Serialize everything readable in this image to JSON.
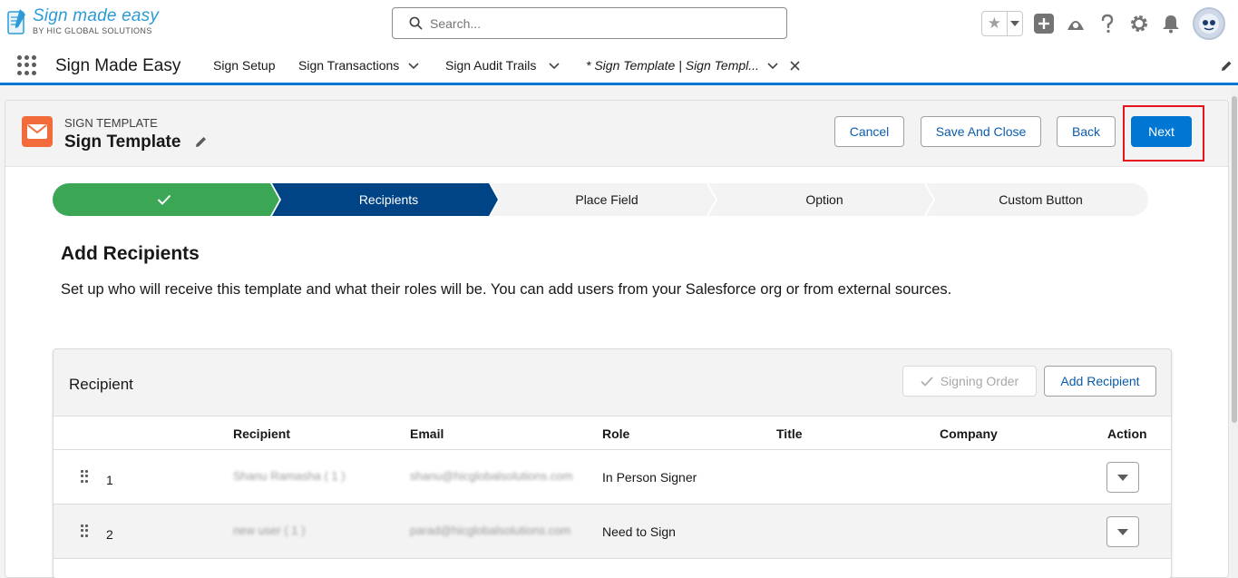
{
  "brand": {
    "title": "Sign made easy",
    "subtitle": "BY HIC GLOBAL SOLUTIONS"
  },
  "search": {
    "placeholder": "Search..."
  },
  "app_nav": {
    "app_name": "Sign Made Easy",
    "items": [
      {
        "label": "Sign Setup",
        "has_menu": false
      },
      {
        "label": "Sign Transactions",
        "has_menu": true
      },
      {
        "label": "Sign Audit Trails",
        "has_menu": true
      },
      {
        "label": "* Sign Template | Sign Templ...",
        "has_menu": true,
        "active": true,
        "closable": true
      }
    ]
  },
  "record": {
    "type_label": "SIGN TEMPLATE",
    "title": "Sign Template",
    "icon": "email-icon",
    "buttons": {
      "cancel": "Cancel",
      "save_close": "Save And Close",
      "back": "Back",
      "next": "Next"
    }
  },
  "path": {
    "steps": [
      {
        "label": "",
        "status": "complete"
      },
      {
        "label": "Recipients",
        "status": "current"
      },
      {
        "label": "Place Field",
        "status": "incomplete"
      },
      {
        "label": "Option",
        "status": "incomplete"
      },
      {
        "label": "Custom Button",
        "status": "incomplete"
      }
    ]
  },
  "section": {
    "title": "Add Recipients",
    "description": "Set up who will receive this template and what their roles will be. You can add users from your Salesforce org or from external sources."
  },
  "recipient_card": {
    "title": "Recipient",
    "signing_order_label": "Signing Order",
    "add_recipient_label": "Add Recipient",
    "columns": [
      "Recipient",
      "Email",
      "Role",
      "Title",
      "Company",
      "Action"
    ],
    "rows": [
      {
        "index": "1",
        "recipient": "Shanu Ramasha ( 1 )",
        "email": "shanu@hicglobalsolutions.com",
        "role": "In Person Signer",
        "title": "",
        "company": ""
      },
      {
        "index": "2",
        "recipient": "new user ( 1 )",
        "email": "parad@hicglobalsolutions.com",
        "role": "Need to Sign",
        "title": "",
        "company": ""
      }
    ]
  },
  "colors": {
    "brand_blue": "#0176d3",
    "path_complete": "#3ba755",
    "path_current": "#014486",
    "path_incomplete": "#f3f3f3",
    "highlight": "#e8141b",
    "record_icon": "#f26b3a"
  }
}
